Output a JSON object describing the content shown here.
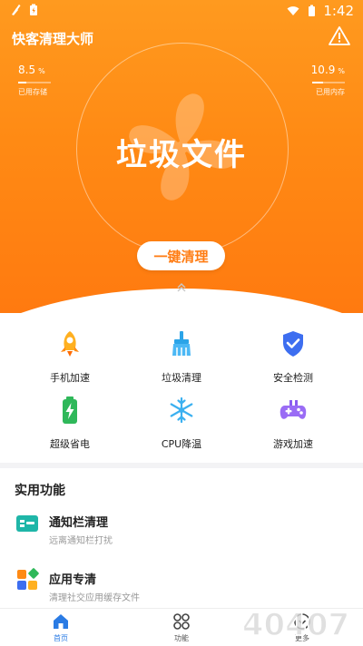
{
  "status_bar": {
    "time": "1:42"
  },
  "app": {
    "title": "快客清理大师"
  },
  "stats": {
    "storage": {
      "value": "8.5",
      "unit": "%",
      "label": "已用存储",
      "fraction": 0.085
    },
    "memory": {
      "value": "10.9",
      "unit": "%",
      "label": "已用内存",
      "fraction": 0.109
    }
  },
  "hero": {
    "main_text": "垃圾文件",
    "button_label": "一键清理"
  },
  "grid": [
    {
      "label": "手机加速",
      "icon": "rocket-icon"
    },
    {
      "label": "垃圾清理",
      "icon": "broom-icon"
    },
    {
      "label": "安全检测",
      "icon": "shield-icon"
    },
    {
      "label": "超级省电",
      "icon": "battery-icon"
    },
    {
      "label": "CPU降温",
      "icon": "snowflake-icon"
    },
    {
      "label": "游戏加速",
      "icon": "gamepad-icon"
    }
  ],
  "section": {
    "title": "实用功能"
  },
  "features": [
    {
      "title": "通知栏清理",
      "subtitle": "远离通知栏打扰",
      "icon": "notification-icon"
    },
    {
      "title": "应用专清",
      "subtitle": "清理社交应用缓存文件",
      "icon": "apps-icon"
    }
  ],
  "nav": [
    {
      "label": "首页",
      "icon": "home-icon"
    },
    {
      "label": "功能",
      "icon": "functions-icon"
    },
    {
      "label": "更多",
      "icon": "more-icon"
    }
  ],
  "watermark": {
    "text": "40407"
  },
  "colors": {
    "brand_orange": "#ff8a14",
    "accent_blue": "#2a7be4"
  }
}
